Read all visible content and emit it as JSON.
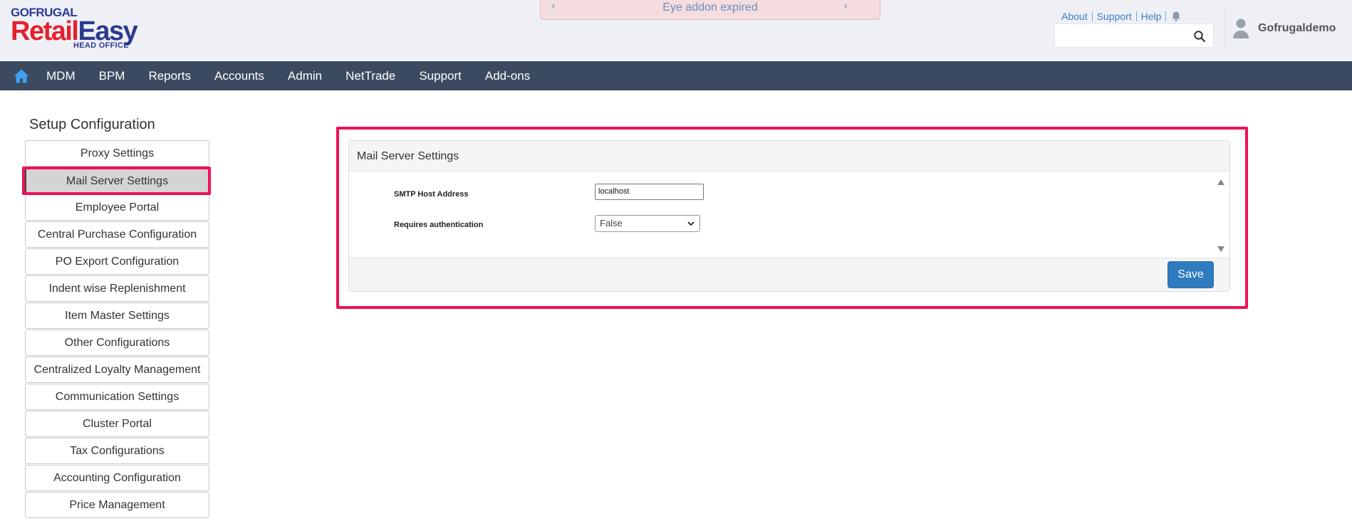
{
  "header": {
    "logo_top": "GOFRUGAL",
    "logo_retail": "Retail",
    "logo_easy": "Easy",
    "logo_sub": "HEAD OFFICE",
    "notice": "Eye addon expired",
    "links": [
      "About",
      "Support",
      "Help"
    ],
    "search_placeholder": "",
    "username": "Gofrugaldemo"
  },
  "nav": {
    "items": [
      "MDM",
      "BPM",
      "Reports",
      "Accounts",
      "Admin",
      "NetTrade",
      "Support",
      "Add-ons"
    ]
  },
  "sidebar": {
    "title": "Setup Configuration",
    "items": [
      "Proxy Settings",
      "Mail Server Settings",
      "Employee Portal",
      "Central Purchase Configuration",
      "PO Export Configuration",
      "Indent wise Replenishment",
      "Item Master Settings",
      "Other Configurations",
      "Centralized Loyalty Management",
      "Communication Settings",
      "Cluster Portal",
      "Tax Configurations",
      "Accounting Configuration",
      "Price Management"
    ],
    "active_index": 1
  },
  "panel": {
    "title": "Mail Server Settings",
    "smtp_label": "SMTP Host Address",
    "smtp_value": "localhost",
    "auth_label": "Requires authentication",
    "auth_value": "False",
    "save_label": "Save"
  },
  "colors": {
    "nav_bg": "#3b4a5f",
    "highlight": "#ee1155",
    "save_button": "#2f7bc0",
    "link": "#3d7ac7"
  }
}
